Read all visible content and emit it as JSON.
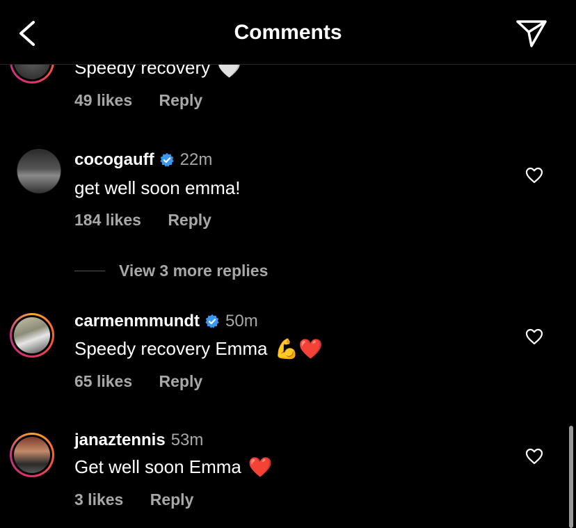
{
  "header": {
    "title": "Comments",
    "back_icon": "chevron-left-icon",
    "send_icon": "paper-plane-icon"
  },
  "comments": [
    {
      "username": "",
      "time": "",
      "text": "Speedy recovery",
      "emoji": "🤍",
      "likes": "49 likes",
      "reply": "Reply"
    },
    {
      "username": "cocogauff",
      "verified": true,
      "time": "22m",
      "text": "get well soon emma!",
      "likes": "184 likes",
      "reply": "Reply"
    },
    {
      "username": "carmenmmundt",
      "verified": true,
      "time": "50m",
      "text": "Speedy recovery Emma",
      "emoji": "💪❤️",
      "likes": "65 likes",
      "reply": "Reply"
    },
    {
      "username": "janaztennis",
      "verified": false,
      "time": "53m",
      "text": "Get well soon Emma",
      "emoji": "❤️",
      "likes": "3 likes",
      "reply": "Reply"
    }
  ],
  "view_replies": "View 3 more replies",
  "colors": {
    "background": "#000000",
    "muted_text": "#a8a8a8",
    "verified_blue": "#3897f0",
    "heart_red": "#ed4956"
  }
}
